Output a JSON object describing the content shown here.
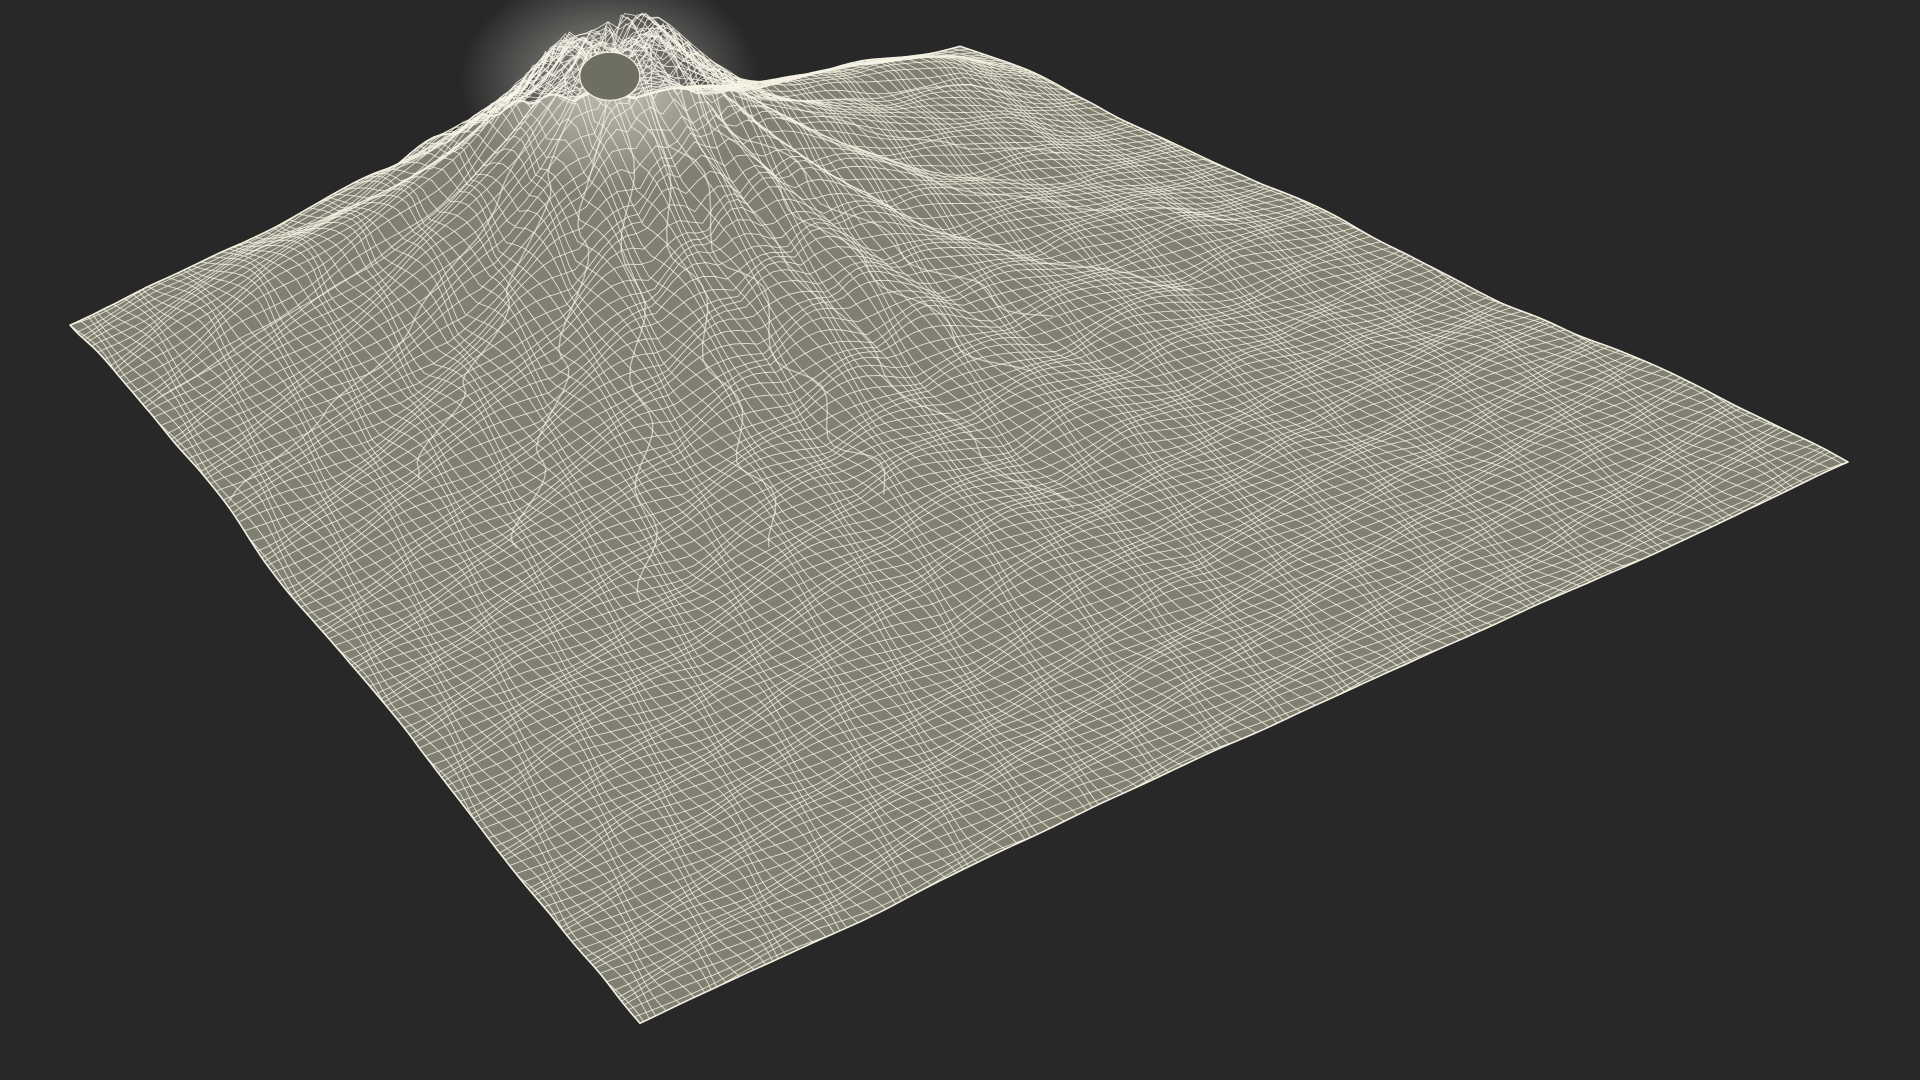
{
  "scene": {
    "subject": "volcano-terrain-wireframe",
    "colors": {
      "background": "#282828",
      "surface": "#7f7f72",
      "wire": "#f4f1e2",
      "wire_highlight": "#fbf9ee"
    },
    "mesh": {
      "u_lines": 120,
      "v_lines": 120
    }
  }
}
